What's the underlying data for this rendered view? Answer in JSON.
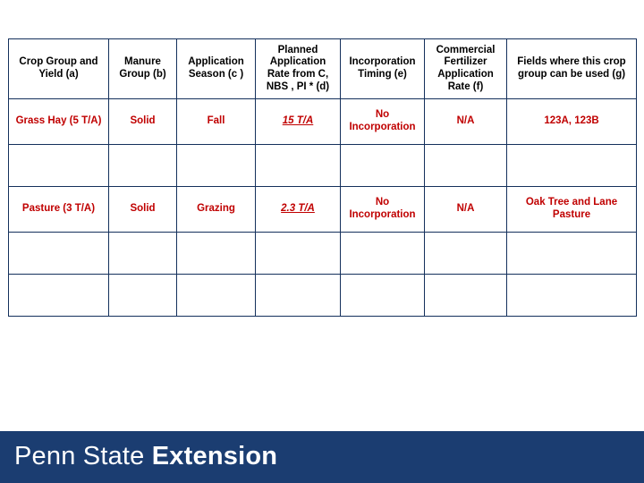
{
  "table": {
    "headers": [
      "Crop Group and Yield (a)",
      "Manure Group (b)",
      "Application Season (c )",
      "Planned Application Rate from C, NBS , PI * (d)",
      "Incorporation Timing (e)",
      "Commercial Fertilizer Application Rate (f)",
      "Fields where this crop group can be used (g)"
    ],
    "rows": [
      {
        "type": "data",
        "cells": [
          "Grass Hay (5 T/A)",
          "Solid",
          "Fall",
          "15 T/A",
          "No Incorporation",
          "N/A",
          "123A, 123B"
        ]
      },
      {
        "type": "empty",
        "cells": [
          "",
          "",
          "",
          "",
          "",
          "",
          ""
        ]
      },
      {
        "type": "data",
        "cells": [
          "Pasture (3 T/A)",
          "Solid",
          "Grazing",
          "2.3 T/A",
          "No Incorporation",
          "N/A",
          "Oak Tree and Lane Pasture"
        ]
      },
      {
        "type": "empty",
        "cells": [
          "",
          "",
          "",
          "",
          "",
          "",
          ""
        ]
      },
      {
        "type": "empty",
        "cells": [
          "",
          "",
          "",
          "",
          "",
          "",
          ""
        ]
      }
    ]
  },
  "footer": {
    "logo_light": "Penn State",
    "logo_bold": "Extension",
    "band_color": "#1b3d71"
  },
  "colors": {
    "table_border": "#14305c",
    "data_text": "#c00000",
    "header_text": "#000000"
  }
}
